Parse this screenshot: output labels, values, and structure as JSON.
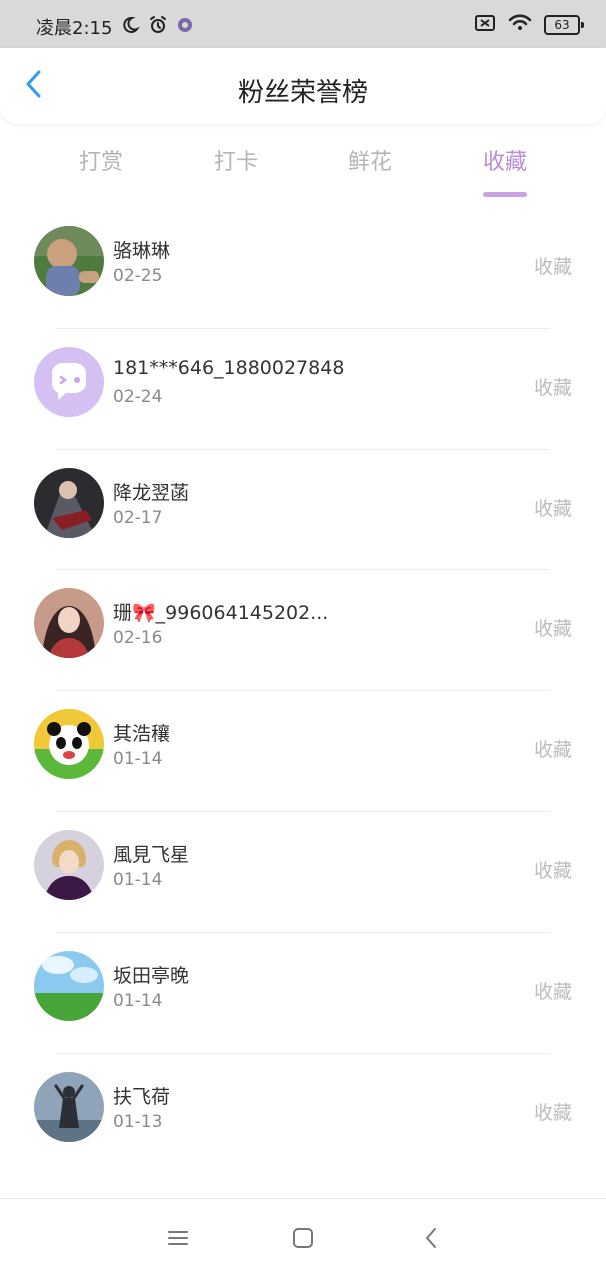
{
  "status_bar": {
    "time": "凌晨2:15",
    "battery": "63"
  },
  "header": {
    "title": "粉丝荣誉榜"
  },
  "tabs": [
    {
      "label": "打赏",
      "active": false
    },
    {
      "label": "打卡",
      "active": false
    },
    {
      "label": "鲜花",
      "active": false
    },
    {
      "label": "收藏",
      "active": true
    }
  ],
  "list": [
    {
      "name": "骆琳琳",
      "date": "02-25",
      "tag": "收藏"
    },
    {
      "name": "181***646_1880027848",
      "date": "02-24",
      "tag": "收藏"
    },
    {
      "name": "降龙翌菡",
      "date": "02-17",
      "tag": "收藏"
    },
    {
      "name": "珊🎀_996064145202...",
      "date": "02-16",
      "tag": "收藏"
    },
    {
      "name": "其浩穰",
      "date": "01-14",
      "tag": "收藏"
    },
    {
      "name": "風見飞星",
      "date": "01-14",
      "tag": "收藏"
    },
    {
      "name": "坂田亭晚",
      "date": "01-14",
      "tag": "收藏"
    },
    {
      "name": "扶飞荷",
      "date": "01-13",
      "tag": "收藏"
    }
  ],
  "colors": {
    "accent": "#b98cd6",
    "back_icon": "#2a9df4"
  }
}
